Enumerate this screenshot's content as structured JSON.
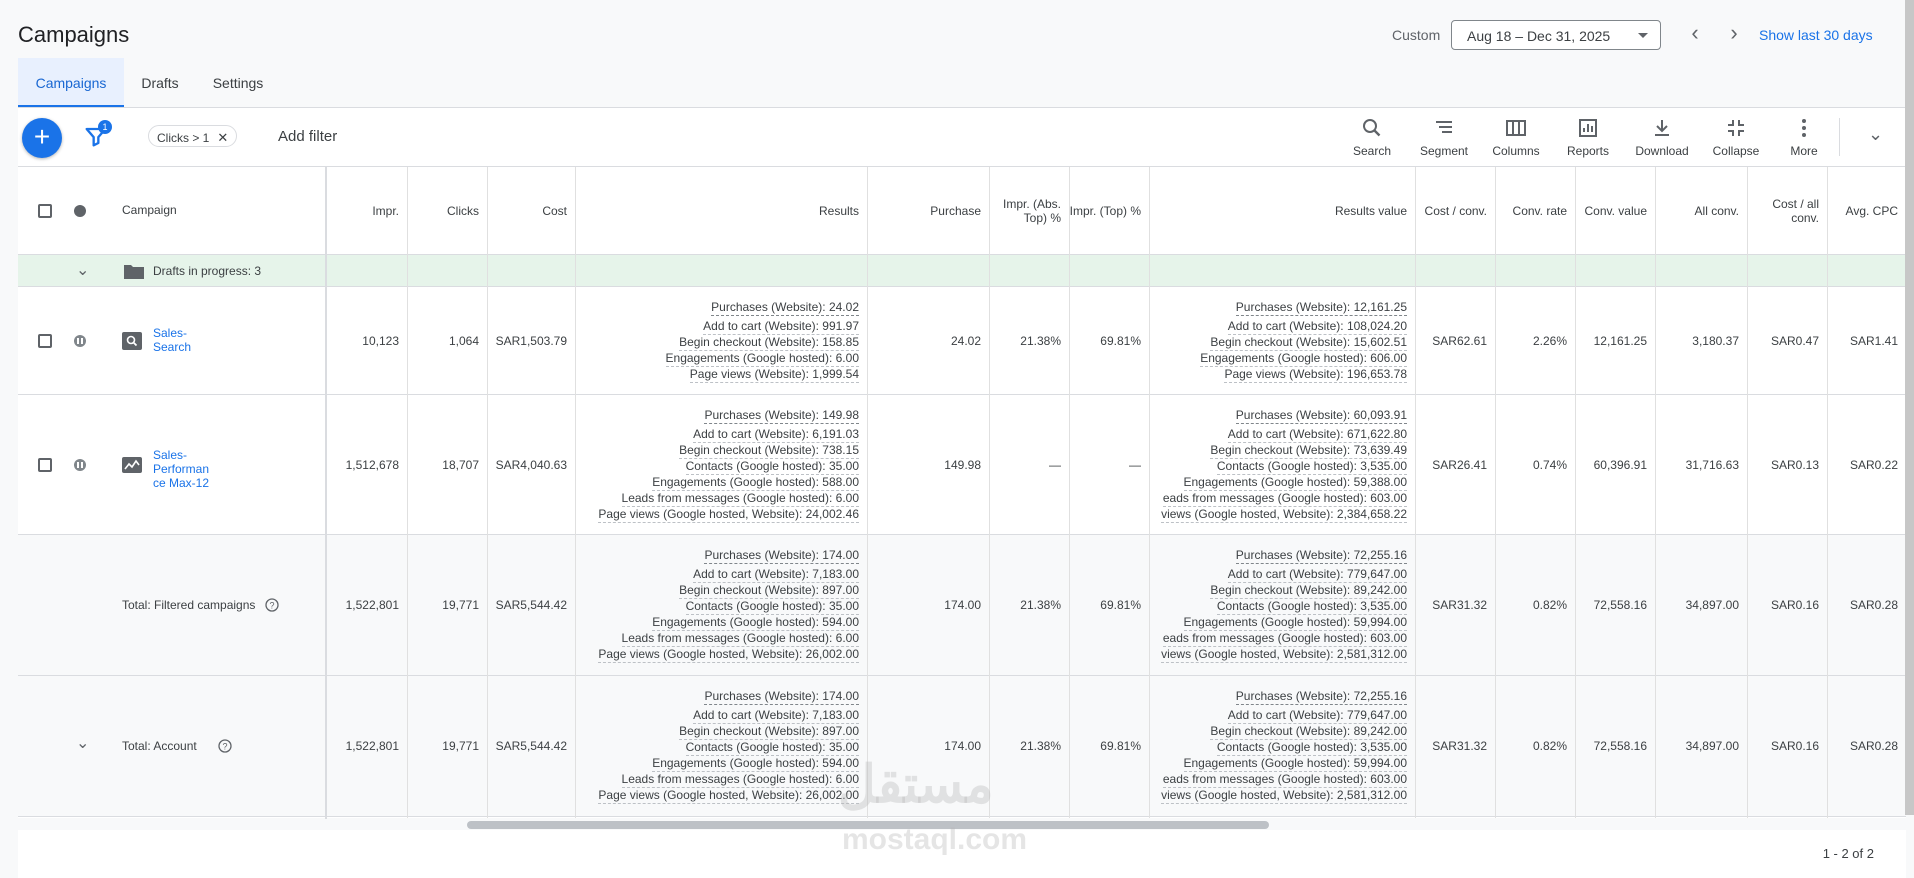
{
  "header": {
    "title": "Campaigns",
    "custom_label": "Custom",
    "date_range": "Aug 18 – Dec 31, 2025",
    "show_last": "Show last 30 days"
  },
  "tabs": [
    {
      "label": "Campaigns"
    },
    {
      "label": "Drafts"
    },
    {
      "label": "Settings"
    }
  ],
  "toolbar": {
    "filter_count": "1",
    "filter_chip": "Clicks > 1",
    "add_filter": "Add filter",
    "tools": [
      {
        "label": "Search",
        "icon": "search-icon"
      },
      {
        "label": "Segment",
        "icon": "segment-icon"
      },
      {
        "label": "Columns",
        "icon": "columns-icon"
      },
      {
        "label": "Reports",
        "icon": "reports-icon"
      },
      {
        "label": "Download",
        "icon": "download-icon"
      },
      {
        "label": "Collapse",
        "icon": "collapse-icon"
      },
      {
        "label": "More",
        "icon": "more-icon"
      }
    ]
  },
  "columns": {
    "campaign": "Campaign",
    "impr": "Impr.",
    "clicks": "Clicks",
    "cost": "Cost",
    "results": "Results",
    "purchase": "Purchase",
    "impr_abs_top": "Impr. (Abs. Top) %",
    "impr_top": "Impr. (Top) %",
    "results_value": "Results value",
    "cost_conv": "Cost / conv.",
    "conv_rate": "Conv. rate",
    "conv_value": "Conv. value",
    "all_conv": "All conv.",
    "cost_all_conv": "Cost / all conv.",
    "avg_cpc": "Avg. CPC"
  },
  "drafts": {
    "label": "Drafts in progress: 3"
  },
  "rows": [
    {
      "campaign": "Sales-Search",
      "campaign_lines": [
        "Sales-",
        "Search"
      ],
      "impr": "10,123",
      "clicks": "1,064",
      "cost": "SAR1,503.79",
      "results": [
        "Purchases (Website): 24.02",
        "Add to cart (Website): 991.97",
        "Begin checkout (Website): 158.85",
        "Engagements (Google hosted): 6.00",
        "Page views (Website): 1,999.54"
      ],
      "purchase": "24.02",
      "impr_abs_top": "21.38%",
      "impr_top": "69.81%",
      "results_value": [
        "Purchases (Website): 12,161.25",
        "Add to cart (Website): 108,024.20",
        "Begin checkout (Website): 15,602.51",
        "Engagements (Google hosted): 606.00",
        "Page views (Website): 196,653.78"
      ],
      "cost_conv": "SAR62.61",
      "conv_rate": "2.26%",
      "conv_value": "12,161.25",
      "all_conv": "3,180.37",
      "cost_all_conv": "SAR0.47",
      "avg_cpc": "SAR1.41"
    },
    {
      "campaign": "Sales-Performance Max-12",
      "campaign_lines": [
        "Sales-",
        "Performan",
        "ce Max-12"
      ],
      "impr": "1,512,678",
      "clicks": "18,707",
      "cost": "SAR4,040.63",
      "results": [
        "Purchases (Website): 149.98",
        "Add to cart (Website): 6,191.03",
        "Begin checkout (Website): 738.15",
        "Contacts (Google hosted): 35.00",
        "Engagements (Google hosted): 588.00",
        "Leads from messages (Google hosted): 6.00",
        "Page views (Google hosted, Website): 24,002.46"
      ],
      "purchase": "149.98",
      "impr_abs_top": "—",
      "impr_top": "—",
      "results_value": [
        "Purchases (Website): 60,093.91",
        "Add to cart (Website): 671,622.80",
        "Begin checkout (Website): 73,639.49",
        "Contacts (Google hosted): 3,535.00",
        "Engagements (Google hosted): 59,388.00",
        "eads from messages (Google hosted): 603.00",
        "views (Google hosted, Website): 2,384,658.22"
      ],
      "cost_conv": "SAR26.41",
      "conv_rate": "0.74%",
      "conv_value": "60,396.91",
      "all_conv": "31,716.63",
      "cost_all_conv": "SAR0.13",
      "avg_cpc": "SAR0.22"
    }
  ],
  "totals": [
    {
      "label": "Total: Filtered campaigns",
      "impr": "1,522,801",
      "clicks": "19,771",
      "cost": "SAR5,544.42",
      "results": [
        "Purchases (Website): 174.00",
        "Add to cart (Website): 7,183.00",
        "Begin checkout (Website): 897.00",
        "Contacts (Google hosted): 35.00",
        "Engagements (Google hosted): 594.00",
        "Leads from messages (Google hosted): 6.00",
        "Page views (Google hosted, Website): 26,002.00"
      ],
      "purchase": "174.00",
      "impr_abs_top": "21.38%",
      "impr_top": "69.81%",
      "results_value": [
        "Purchases (Website): 72,255.16",
        "Add to cart (Website): 779,647.00",
        "Begin checkout (Website): 89,242.00",
        "Contacts (Google hosted): 3,535.00",
        "Engagements (Google hosted): 59,994.00",
        "eads from messages (Google hosted): 603.00",
        "views (Google hosted, Website): 2,581,312.00"
      ],
      "cost_conv": "SAR31.32",
      "conv_rate": "0.82%",
      "conv_value": "72,558.16",
      "all_conv": "34,897.00",
      "cost_all_conv": "SAR0.16",
      "avg_cpc": "SAR0.28"
    },
    {
      "label": "Total: Account",
      "impr": "1,522,801",
      "clicks": "19,771",
      "cost": "SAR5,544.42",
      "results": [
        "Purchases (Website): 174.00",
        "Add to cart (Website): 7,183.00",
        "Begin checkout (Website): 897.00",
        "Contacts (Google hosted): 35.00",
        "Engagements (Google hosted): 594.00",
        "Leads from messages (Google hosted): 6.00",
        "Page views (Google hosted, Website): 26,002.00"
      ],
      "purchase": "174.00",
      "impr_abs_top": "21.38%",
      "impr_top": "69.81%",
      "results_value": [
        "Purchases (Website): 72,255.16",
        "Add to cart (Website): 779,647.00",
        "Begin checkout (Website): 89,242.00",
        "Contacts (Google hosted): 3,535.00",
        "Engagements (Google hosted): 59,994.00",
        "eads from messages (Google hosted): 603.00",
        "views (Google hosted, Website): 2,581,312.00"
      ],
      "cost_conv": "SAR31.32",
      "conv_rate": "0.82%",
      "conv_value": "72,558.16",
      "all_conv": "34,897.00",
      "cost_all_conv": "SAR0.16",
      "avg_cpc": "SAR0.28"
    }
  ],
  "pagination": "1 - 2 of 2",
  "watermark": [
    "مستقل",
    "mostaql.com"
  ],
  "colors": {
    "accent": "#1a73e8",
    "drafts_bg": "#e6f4ea"
  }
}
